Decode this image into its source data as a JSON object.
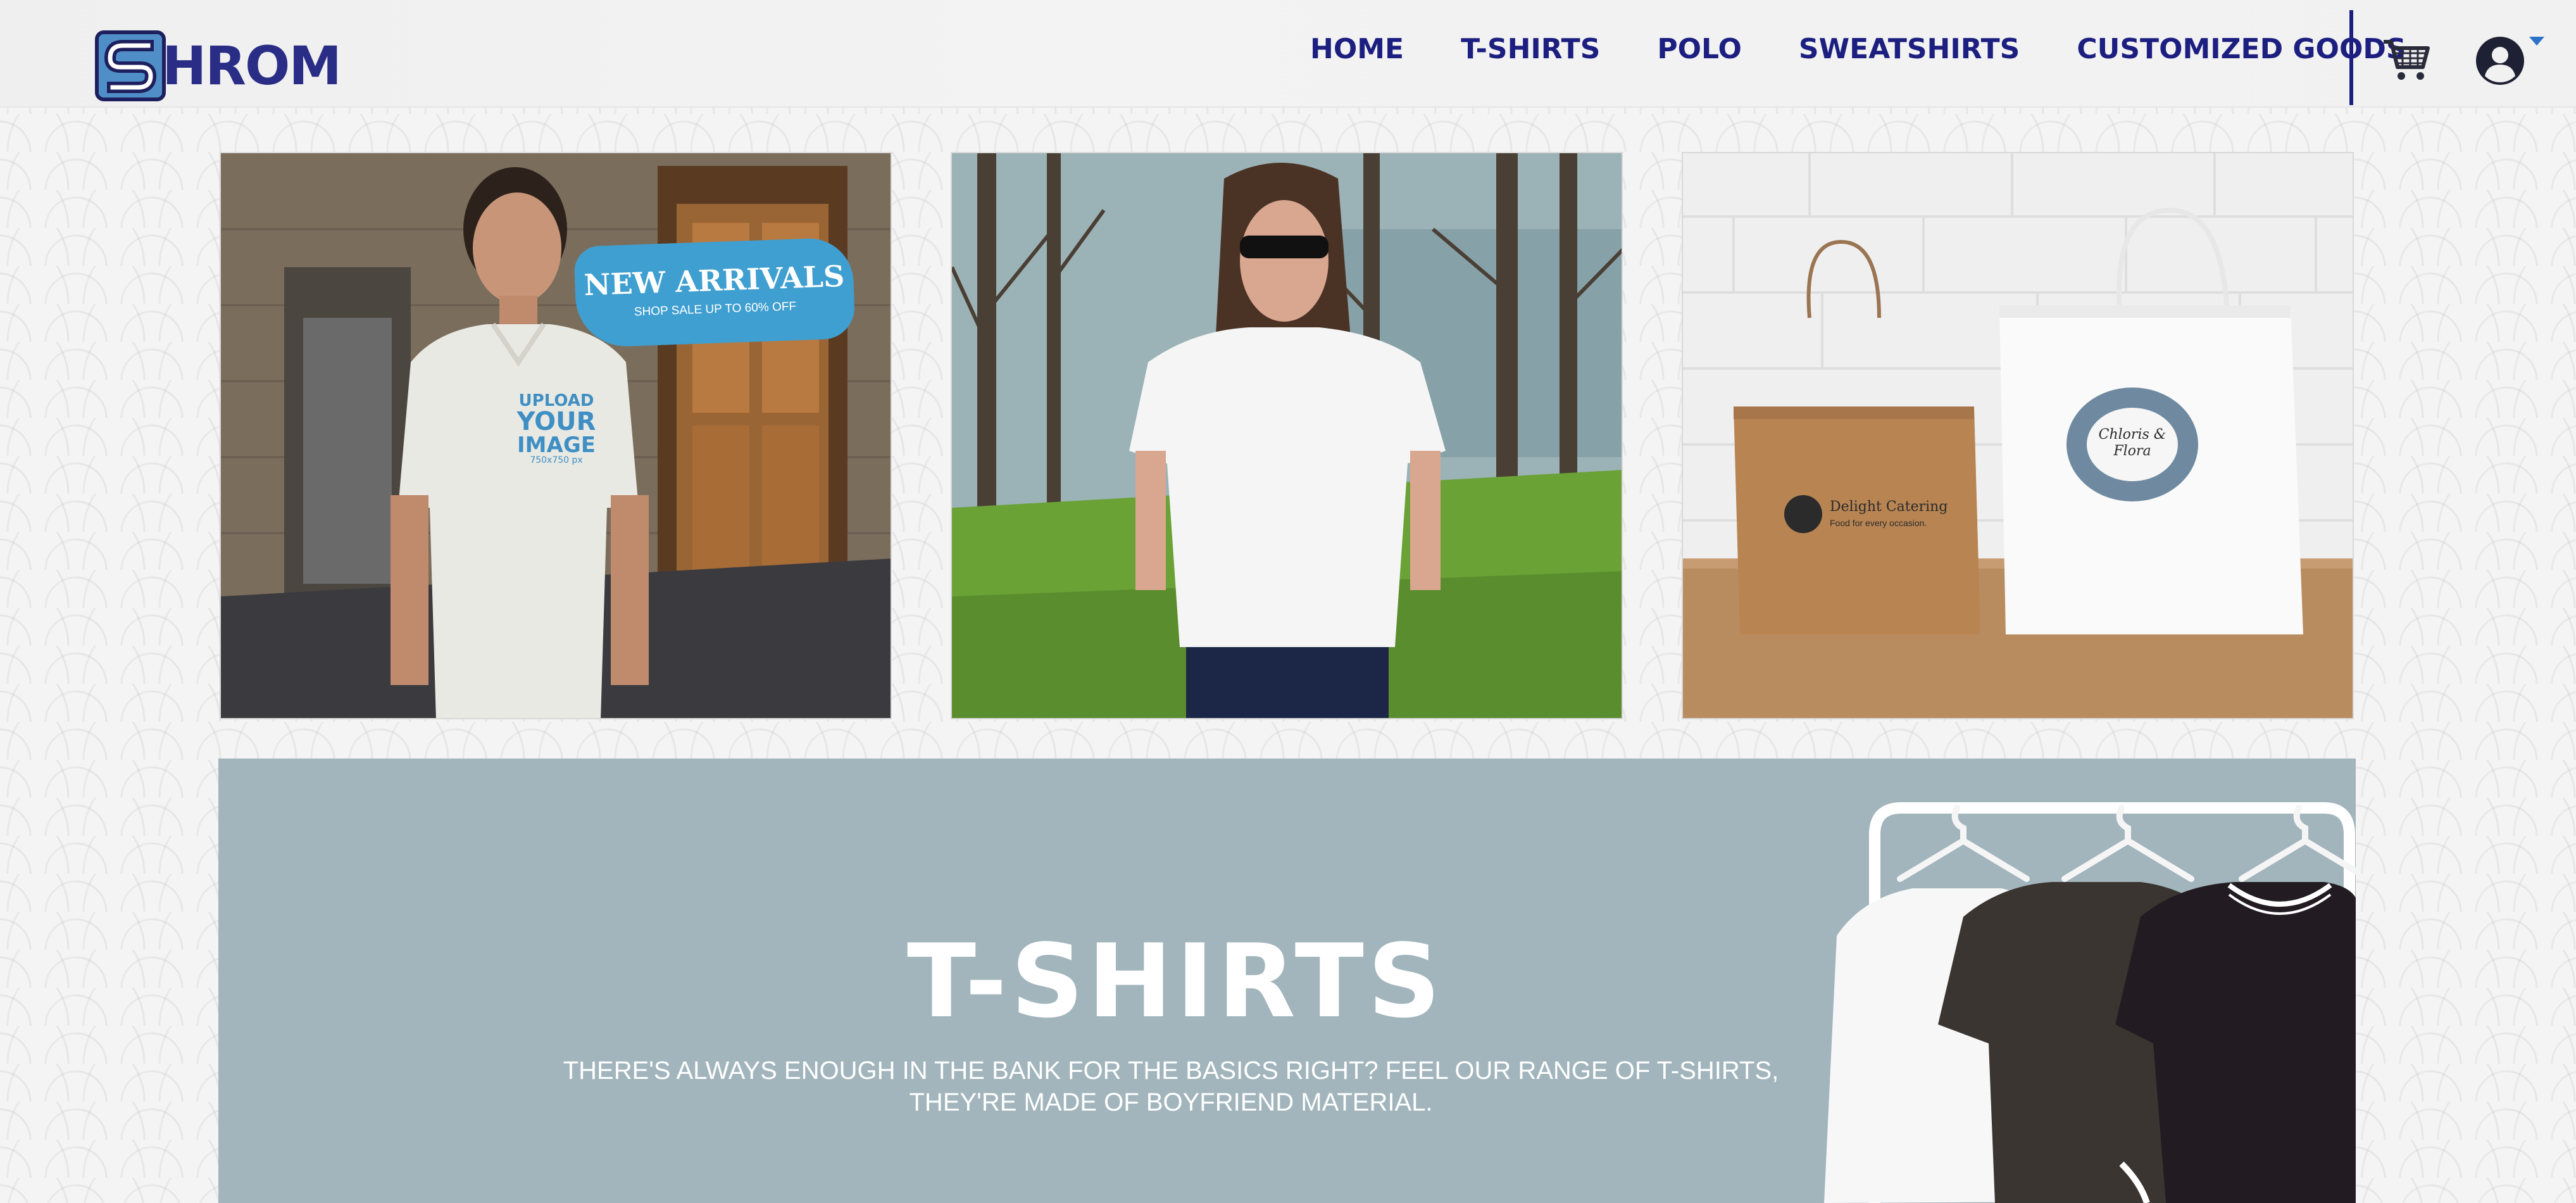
{
  "brand": {
    "logo_text": "HROM",
    "logo_icon": "s-logo-icon"
  },
  "nav": {
    "items": [
      {
        "label": "HOME"
      },
      {
        "label": "T-SHIRTS"
      },
      {
        "label": "POLO"
      },
      {
        "label": "SWEATSHIRTS"
      },
      {
        "label": "CUSTOMIZED GOODS"
      }
    ],
    "cart_icon": "shopping-cart-icon",
    "account_icon": "user-account-icon",
    "account_menu_icon": "caret-down-icon"
  },
  "tiles": [
    {
      "subject": "polo-mockup-photo",
      "badge_title": "NEW ARRIVALS",
      "badge_subtitle": "SHOP SALE UP TO 60% OFF",
      "shirt_text": [
        "UPLOAD",
        "YOUR",
        "IMAGE",
        "750x750 px"
      ]
    },
    {
      "subject": "woman-white-tshirt-photo"
    },
    {
      "subject": "shopping-bags-photo",
      "bag1_name": "Delight Catering",
      "bag1_tagline": "Food for every occasion.",
      "bag2_name": "Chloris & Flora"
    }
  ],
  "banner": {
    "title": "T-SHIRTS",
    "description": "THERE'S ALWAYS ENOUGH IN THE BANK FOR THE BASICS RIGHT? FEEL OUR RANGE OF T-SHIRTS, THEY'RE MADE OF BOYFRIEND MATERIAL."
  },
  "colors": {
    "nav": "#1c1f80",
    "logo": "#2a2d86",
    "banner_bg": "#a2b5bc",
    "badge": "#3f9fd0"
  }
}
